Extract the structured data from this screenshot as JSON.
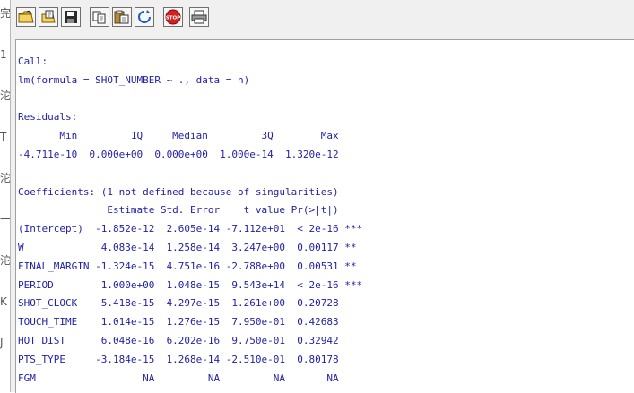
{
  "toolbar": {
    "buttons": [
      {
        "name": "open-script-button",
        "icon": "open-folder-icon"
      },
      {
        "name": "load-workspace-button",
        "icon": "load-workspace-icon"
      },
      {
        "name": "save-workspace-button",
        "icon": "save-disk-icon"
      },
      {
        "name": "copy-button",
        "icon": "copy-icon"
      },
      {
        "name": "paste-button",
        "icon": "paste-icon"
      },
      {
        "name": "copy-paste-button",
        "icon": "refresh-icon"
      },
      {
        "name": "stop-button",
        "icon": "stop-icon",
        "label": "STOP"
      },
      {
        "name": "print-button",
        "icon": "printer-icon"
      }
    ]
  },
  "left_strip": {
    "glyphs": [
      {
        "text": "完",
        "row": 0
      },
      {
        "text": "1",
        "row": 1
      },
      {
        "text": "沱",
        "row": 2
      },
      {
        "text": "T",
        "row": 3
      },
      {
        "text": "沱",
        "row": 4
      },
      {
        "text": "一",
        "row": 5
      },
      {
        "text": "沱",
        "row": 6
      },
      {
        "text": "K",
        "row": 7
      },
      {
        "text": "J",
        "row": 8
      }
    ]
  },
  "console": {
    "lines": [
      "Call:",
      "lm(formula = SHOT_NUMBER ~ ., data = n)",
      "",
      "Residuals:",
      "       Min         1Q     Median         3Q        Max ",
      "-4.711e-10  0.000e+00  0.000e+00  1.000e-14  1.320e-12 ",
      "",
      "Coefficients: (1 not defined because of singularities)",
      "               Estimate Std. Error    t value Pr(>|t|)    ",
      "(Intercept)  -1.852e-12  2.605e-14 -7.112e+01  < 2e-16 ***",
      "W             4.083e-14  1.258e-14  3.247e+00  0.00117 ** ",
      "FINAL_MARGIN -1.324e-15  4.751e-16 -2.788e+00  0.00531 ** ",
      "PERIOD        1.000e+00  1.048e-15  9.543e+14  < 2e-16 ***",
      "SHOT_CLOCK    5.418e-15  4.297e-15  1.261e+00  0.20728    ",
      "TOUCH_TIME    1.014e-15  1.276e-15  7.950e-01  0.42683    ",
      "HOT_DIST      6.048e-16  6.202e-16  9.750e-01  0.32942    ",
      "PTS_TYPE     -3.184e-15  1.268e-14 -2.510e-01  0.80178    ",
      "FGM                  NA         NA         NA       NA    ",
      "---"
    ]
  },
  "colors": {
    "console_text": "#1f1fa8",
    "toolbar_bg": "#f0f0f0",
    "stop_red": "#d42020"
  }
}
